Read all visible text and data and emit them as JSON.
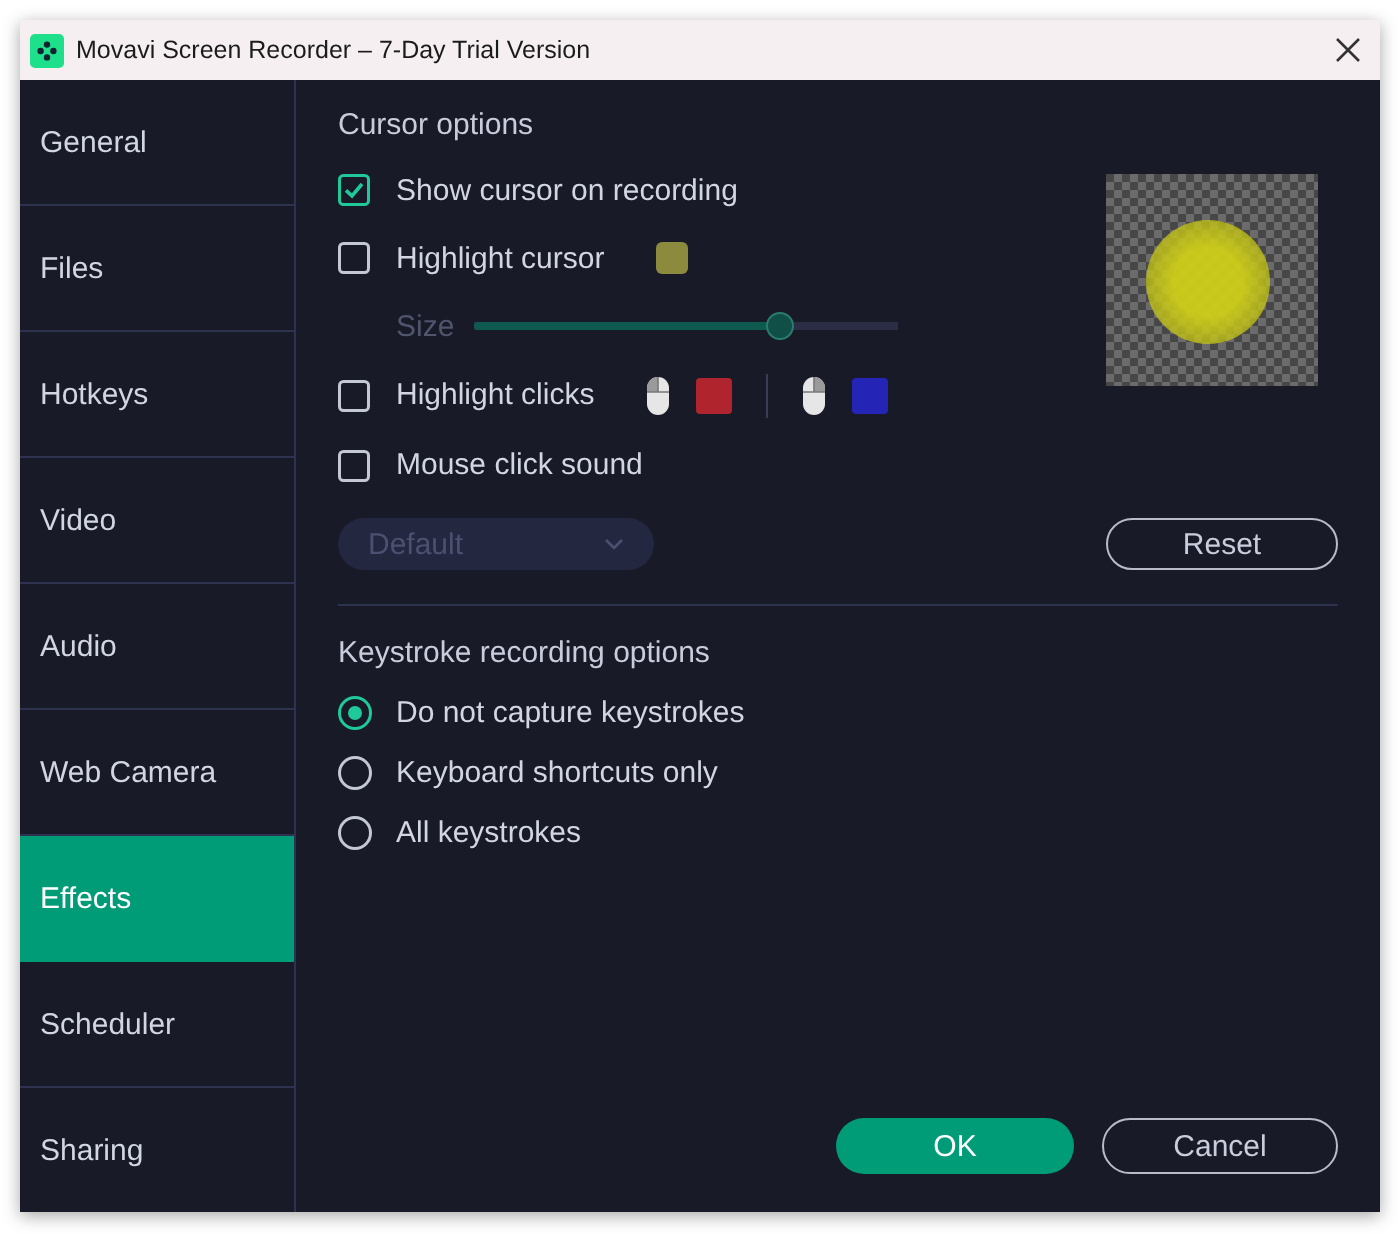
{
  "window": {
    "title": "Movavi Screen Recorder – 7-Day Trial Version"
  },
  "sidebar": {
    "items": [
      {
        "label": "General",
        "selected": false
      },
      {
        "label": "Files",
        "selected": false
      },
      {
        "label": "Hotkeys",
        "selected": false
      },
      {
        "label": "Video",
        "selected": false
      },
      {
        "label": "Audio",
        "selected": false
      },
      {
        "label": "Web Camera",
        "selected": false
      },
      {
        "label": "Effects",
        "selected": true
      },
      {
        "label": "Scheduler",
        "selected": false
      },
      {
        "label": "Sharing",
        "selected": false
      }
    ]
  },
  "cursor_options": {
    "heading": "Cursor options",
    "items": [
      {
        "kind": "checkbox",
        "label": "Show cursor on recording",
        "checked": true
      },
      {
        "kind": "checkbox",
        "label": "Highlight cursor",
        "checked": false,
        "swatches": [
          {
            "kind": "cursor",
            "color": "#8c8b3d"
          }
        ]
      },
      {
        "kind": "slider",
        "label": "Size",
        "level": 0.72,
        "disabled": true
      },
      {
        "kind": "checkbox",
        "label": "Highlight clicks",
        "checked": false,
        "swatches": [
          {
            "kind": "left",
            "color": "#b0252d"
          },
          {
            "kind": "right",
            "color": "#2424b6"
          }
        ]
      },
      {
        "kind": "checkbox",
        "label": "Mouse click sound",
        "checked": false
      }
    ],
    "sound_dropdown": {
      "value": "Default",
      "disabled": true
    },
    "reset_button": {
      "label": "Reset"
    }
  },
  "keystroke_options": {
    "heading": "Keystroke recording options",
    "items": [
      {
        "label": "Do not capture keystrokes",
        "selected": true
      },
      {
        "label": "Keyboard shortcuts only",
        "selected": false
      },
      {
        "label": "All keystrokes",
        "selected": false
      }
    ]
  },
  "footer": {
    "buttons": [
      {
        "kind": "primary",
        "label": "OK"
      },
      {
        "kind": "secondary",
        "label": "Cancel"
      }
    ]
  }
}
